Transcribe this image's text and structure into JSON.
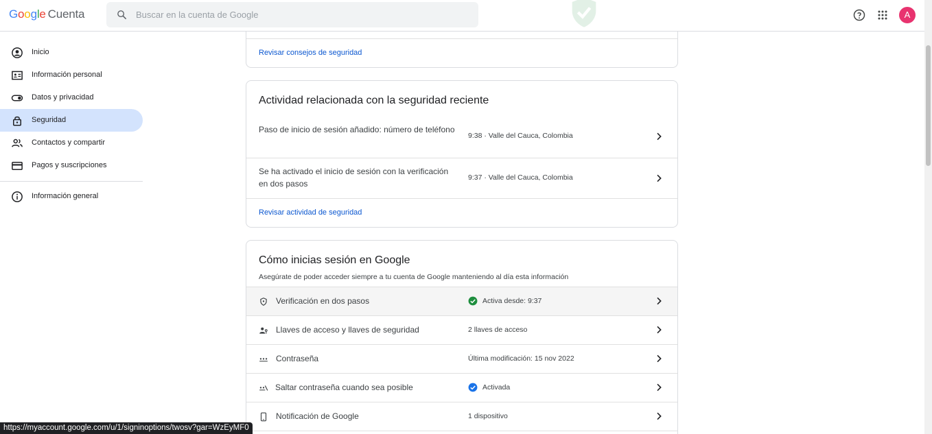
{
  "header": {
    "logo_letters": [
      "G",
      "o",
      "o",
      "g",
      "l",
      "e"
    ],
    "product": "Cuenta",
    "search_placeholder": "Buscar en la cuenta de Google",
    "avatar_letter": "A"
  },
  "sidebar": {
    "items": [
      {
        "label": "Inicio",
        "icon": "account-circle-icon"
      },
      {
        "label": "Información personal",
        "icon": "id-card-icon"
      },
      {
        "label": "Datos y privacidad",
        "icon": "toggle-icon"
      },
      {
        "label": "Seguridad",
        "icon": "lock-icon",
        "active": true
      },
      {
        "label": "Contactos y compartir",
        "icon": "people-icon"
      },
      {
        "label": "Pagos y suscripciones",
        "icon": "credit-card-icon"
      }
    ],
    "footer_item": {
      "label": "Información general",
      "icon": "info-icon"
    }
  },
  "security_tips_card": {
    "link": "Revisar consejos de seguridad"
  },
  "recent_activity_card": {
    "title": "Actividad relacionada con la seguridad reciente",
    "rows": [
      {
        "label": "Paso de inicio de sesión añadido: número de teléfono",
        "meta": "9:38 · Valle del Cauca, Colombia"
      },
      {
        "label": "Se ha activado el inicio de sesión con la verificación en dos pasos",
        "meta": "9:37 · Valle del Cauca, Colombia"
      }
    ],
    "link": "Revisar actividad de seguridad"
  },
  "signin_card": {
    "title": "Cómo inicias sesión en Google",
    "subtitle": "Asegúrate de poder acceder siempre a tu cuenta de Google manteniendo al día esta información",
    "rows": [
      {
        "label": "Verificación en dos pasos",
        "icon": "shield-icon",
        "status_icon": "check-circle-green-icon",
        "meta": "Activa desde: 9:37",
        "highlighted": true
      },
      {
        "label": "Llaves de acceso y llaves de seguridad",
        "icon": "passkey-icon",
        "meta": "2 llaves de acceso"
      },
      {
        "label": "Contraseña",
        "icon": "password-dots-icon",
        "meta": "Última modificación: 15 nov 2022"
      },
      {
        "label": "Saltar contraseña cuando sea posible",
        "icon": "skip-password-icon",
        "status_icon": "check-circle-blue-icon",
        "meta": "Activada"
      },
      {
        "label": "Notificación de Google",
        "icon": "phone-icon",
        "meta": "1 dispositivo"
      }
    ]
  },
  "status_bar": {
    "url": "https://myaccount.google.com/u/1/signinoptions/twosv?gar=WzEyMF0"
  },
  "colors": {
    "accent_blue": "#0b57d0",
    "active_nav_bg": "#d3e3fd",
    "success_green": "#1e8e3e",
    "avatar_pink": "#e8336f"
  }
}
